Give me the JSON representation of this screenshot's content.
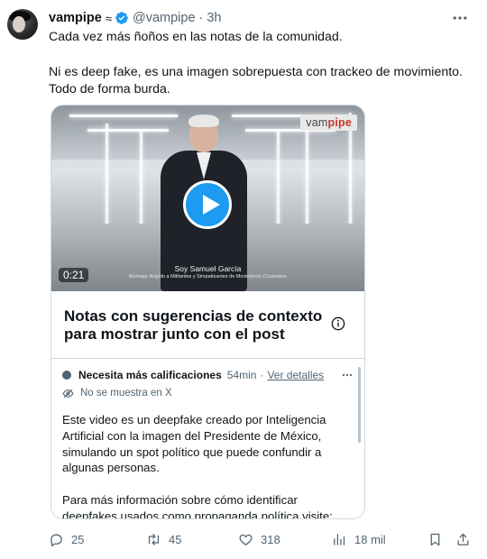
{
  "post": {
    "author_name": "vampipe",
    "name_suffix": "≈",
    "handle": "@vampipe",
    "separator": "·",
    "time": "3h",
    "text_line1": "Cada vez más ñoños en las notas de la comunidad.",
    "text_line2": "Ni es deep fake, es una imagen sobrepuesta con trackeo de movimiento. Todo de forma burda."
  },
  "video": {
    "watermark_pre": "vam",
    "watermark_bold": "pipe",
    "duration": "0:21",
    "caption_line1": "Soy Samuel García",
    "caption_line2": "Mensaje dirigido a Militantes y Simpatizantes de Movimiento Ciudadano"
  },
  "community_notes": {
    "title": "Notas con sugerencias de contexto para mostrar junto con el post",
    "status_label": "Necesita más calificaciones",
    "status_time": "54min",
    "status_separator": "·",
    "details_link": "Ver detalles",
    "hidden_text": "No se muestra en X",
    "body_p1": "Este video es un deepfake creado por Inteligencia Artificial con la imagen del Presidente de México, simulando un spot político que puede confundir a algunas personas.",
    "body_p2": "Para más información sobre cómo identificar deepfakes usados como propaganda política visite:"
  },
  "actions": {
    "replies": "25",
    "reposts": "45",
    "likes": "318",
    "views": "18 mil"
  },
  "colors": {
    "accent": "#1d9bf0",
    "text_primary": "#0f1419",
    "text_secondary": "#536471",
    "border": "#cfd9de"
  },
  "icons": [
    "verified-badge-icon",
    "more-icon",
    "play-icon",
    "info-icon",
    "eye-off-icon",
    "reply-icon",
    "repost-icon",
    "like-icon",
    "views-icon",
    "bookmark-icon",
    "share-icon"
  ]
}
